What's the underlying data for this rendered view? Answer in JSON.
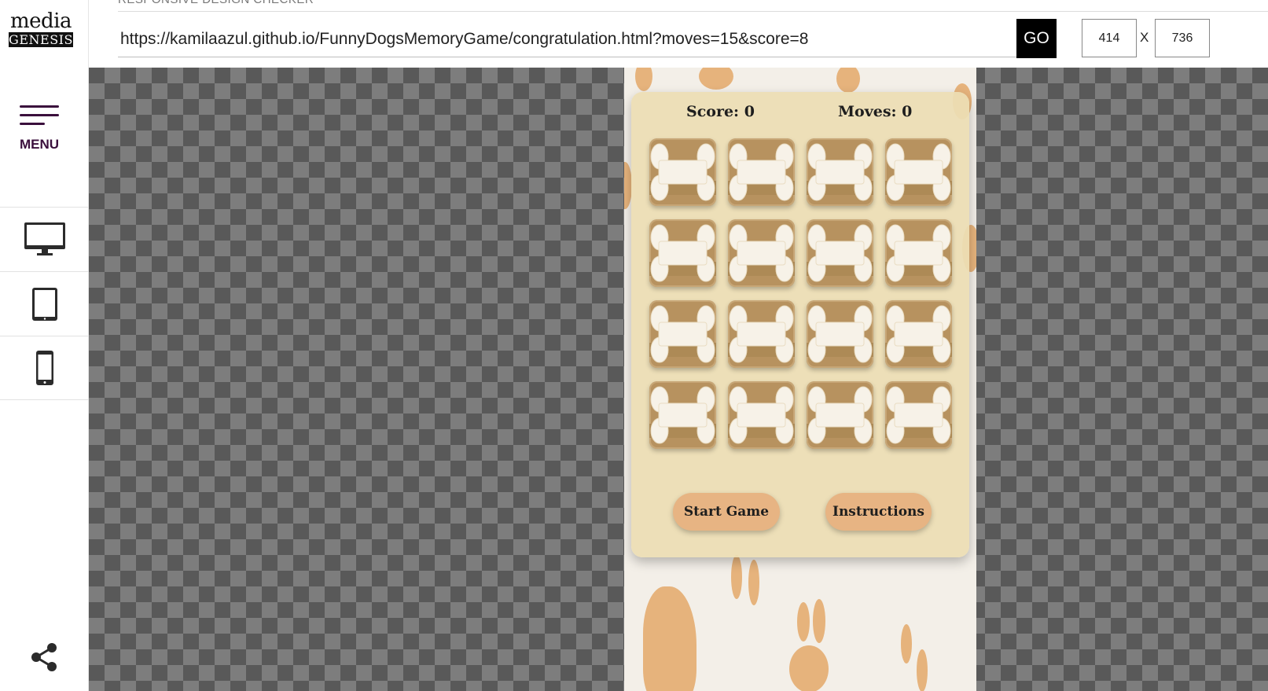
{
  "sidebar": {
    "logo": {
      "top": "media",
      "bottom": "GENESIS"
    },
    "menu_label": "MENU",
    "devices": [
      {
        "name": "desktop",
        "icon": "desktop-icon"
      },
      {
        "name": "tablet",
        "icon": "tablet-icon"
      },
      {
        "name": "mobile",
        "icon": "mobile-icon"
      }
    ],
    "share_icon": "share-icon"
  },
  "topbar": {
    "title": "RESPONSIVE DESIGN CHECKER",
    "url": "https://kamilaazul.github.io/FunnyDogsMemoryGame/congratulation.html?moves=15&score=8",
    "go_label": "GO",
    "width_value": "414",
    "separator": "X",
    "height_value": "736"
  },
  "game": {
    "score_label": "Score: 0",
    "moves_label": "Moves: 0",
    "tile_count": 16,
    "tile_icon": "bone-icon",
    "start_button": "Start Game",
    "instructions_button": "Instructions"
  },
  "colors": {
    "accent_purple": "#3a0f3c",
    "card_bg": "#ecdeb4",
    "tile_brown": "#b7925f",
    "button_peach": "#e7b483",
    "paw_orange": "#e3a868"
  }
}
